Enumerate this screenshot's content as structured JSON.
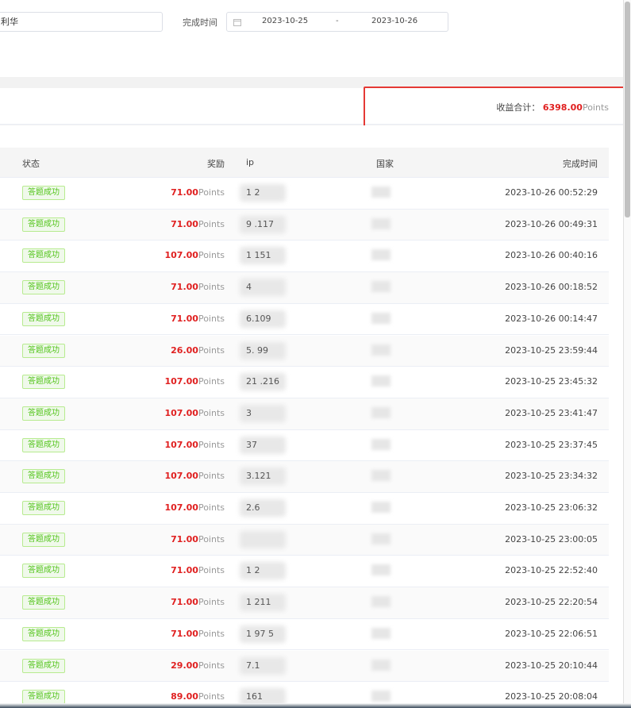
{
  "filter": {
    "name_value": "利华",
    "date_label": "完成时间",
    "date_start": "2023-10-25",
    "date_sep": "-",
    "date_end": "2023-10-26"
  },
  "summary": {
    "label": "收益合计：",
    "value": "6398.00",
    "unit": "Points"
  },
  "table": {
    "headers": {
      "status": "状态",
      "reward": "奖励",
      "ip": "ip",
      "country": "国家",
      "time": "完成时间"
    },
    "rows": [
      {
        "status": "答题成功",
        "reward": "71.00",
        "unit": "Points",
        "ip": "1          2",
        "time": "2023-10-26 00:52:29"
      },
      {
        "status": "答题成功",
        "reward": "71.00",
        "unit": "Points",
        "ip": "9          .117",
        "time": "2023-10-26 00:49:31"
      },
      {
        "status": "答题成功",
        "reward": "107.00",
        "unit": "Points",
        "ip": "  1      151",
        "time": "2023-10-26 00:40:16"
      },
      {
        "status": "答题成功",
        "reward": "71.00",
        "unit": "Points",
        "ip": "           4",
        "time": "2023-10-26 00:18:52"
      },
      {
        "status": "答题成功",
        "reward": "71.00",
        "unit": "Points",
        "ip": "          6.109",
        "time": "2023-10-26 00:14:47"
      },
      {
        "status": "答题成功",
        "reward": "26.00",
        "unit": "Points",
        "ip": "5.         99",
        "time": "2023-10-25 23:59:44"
      },
      {
        "status": "答题成功",
        "reward": "107.00",
        "unit": "Points",
        "ip": "21          .216",
        "time": "2023-10-25 23:45:32"
      },
      {
        "status": "答题成功",
        "reward": "107.00",
        "unit": "Points",
        "ip": "           3",
        "time": "2023-10-25 23:41:47"
      },
      {
        "status": "答题成功",
        "reward": "107.00",
        "unit": "Points",
        "ip": "          37",
        "time": "2023-10-25 23:37:45"
      },
      {
        "status": "答题成功",
        "reward": "107.00",
        "unit": "Points",
        "ip": "          3.121",
        "time": "2023-10-25 23:34:32"
      },
      {
        "status": "答题成功",
        "reward": "107.00",
        "unit": "Points",
        "ip": "          2.6",
        "time": "2023-10-25 23:06:32"
      },
      {
        "status": "答题成功",
        "reward": "71.00",
        "unit": "Points",
        "ip": "",
        "time": "2023-10-25 23:00:05"
      },
      {
        "status": "答题成功",
        "reward": "71.00",
        "unit": "Points",
        "ip": "          1    2",
        "time": "2023-10-25 22:52:40"
      },
      {
        "status": "答题成功",
        "reward": "71.00",
        "unit": "Points",
        "ip": "          1  211",
        "time": "2023-10-25 22:20:54"
      },
      {
        "status": "答题成功",
        "reward": "71.00",
        "unit": "Points",
        "ip": "1          97  5",
        "time": "2023-10-25 22:06:51"
      },
      {
        "status": "答题成功",
        "reward": "29.00",
        "unit": "Points",
        "ip": "          7.1",
        "time": "2023-10-25 20:10:44"
      },
      {
        "status": "答题成功",
        "reward": "89.00",
        "unit": "Points",
        "ip": "161",
        "time": "2023-10-25 20:08:04"
      }
    ]
  },
  "colors": {
    "accent_red": "#e02020",
    "success_green": "#52c41a",
    "highlight_border": "#e53935"
  }
}
